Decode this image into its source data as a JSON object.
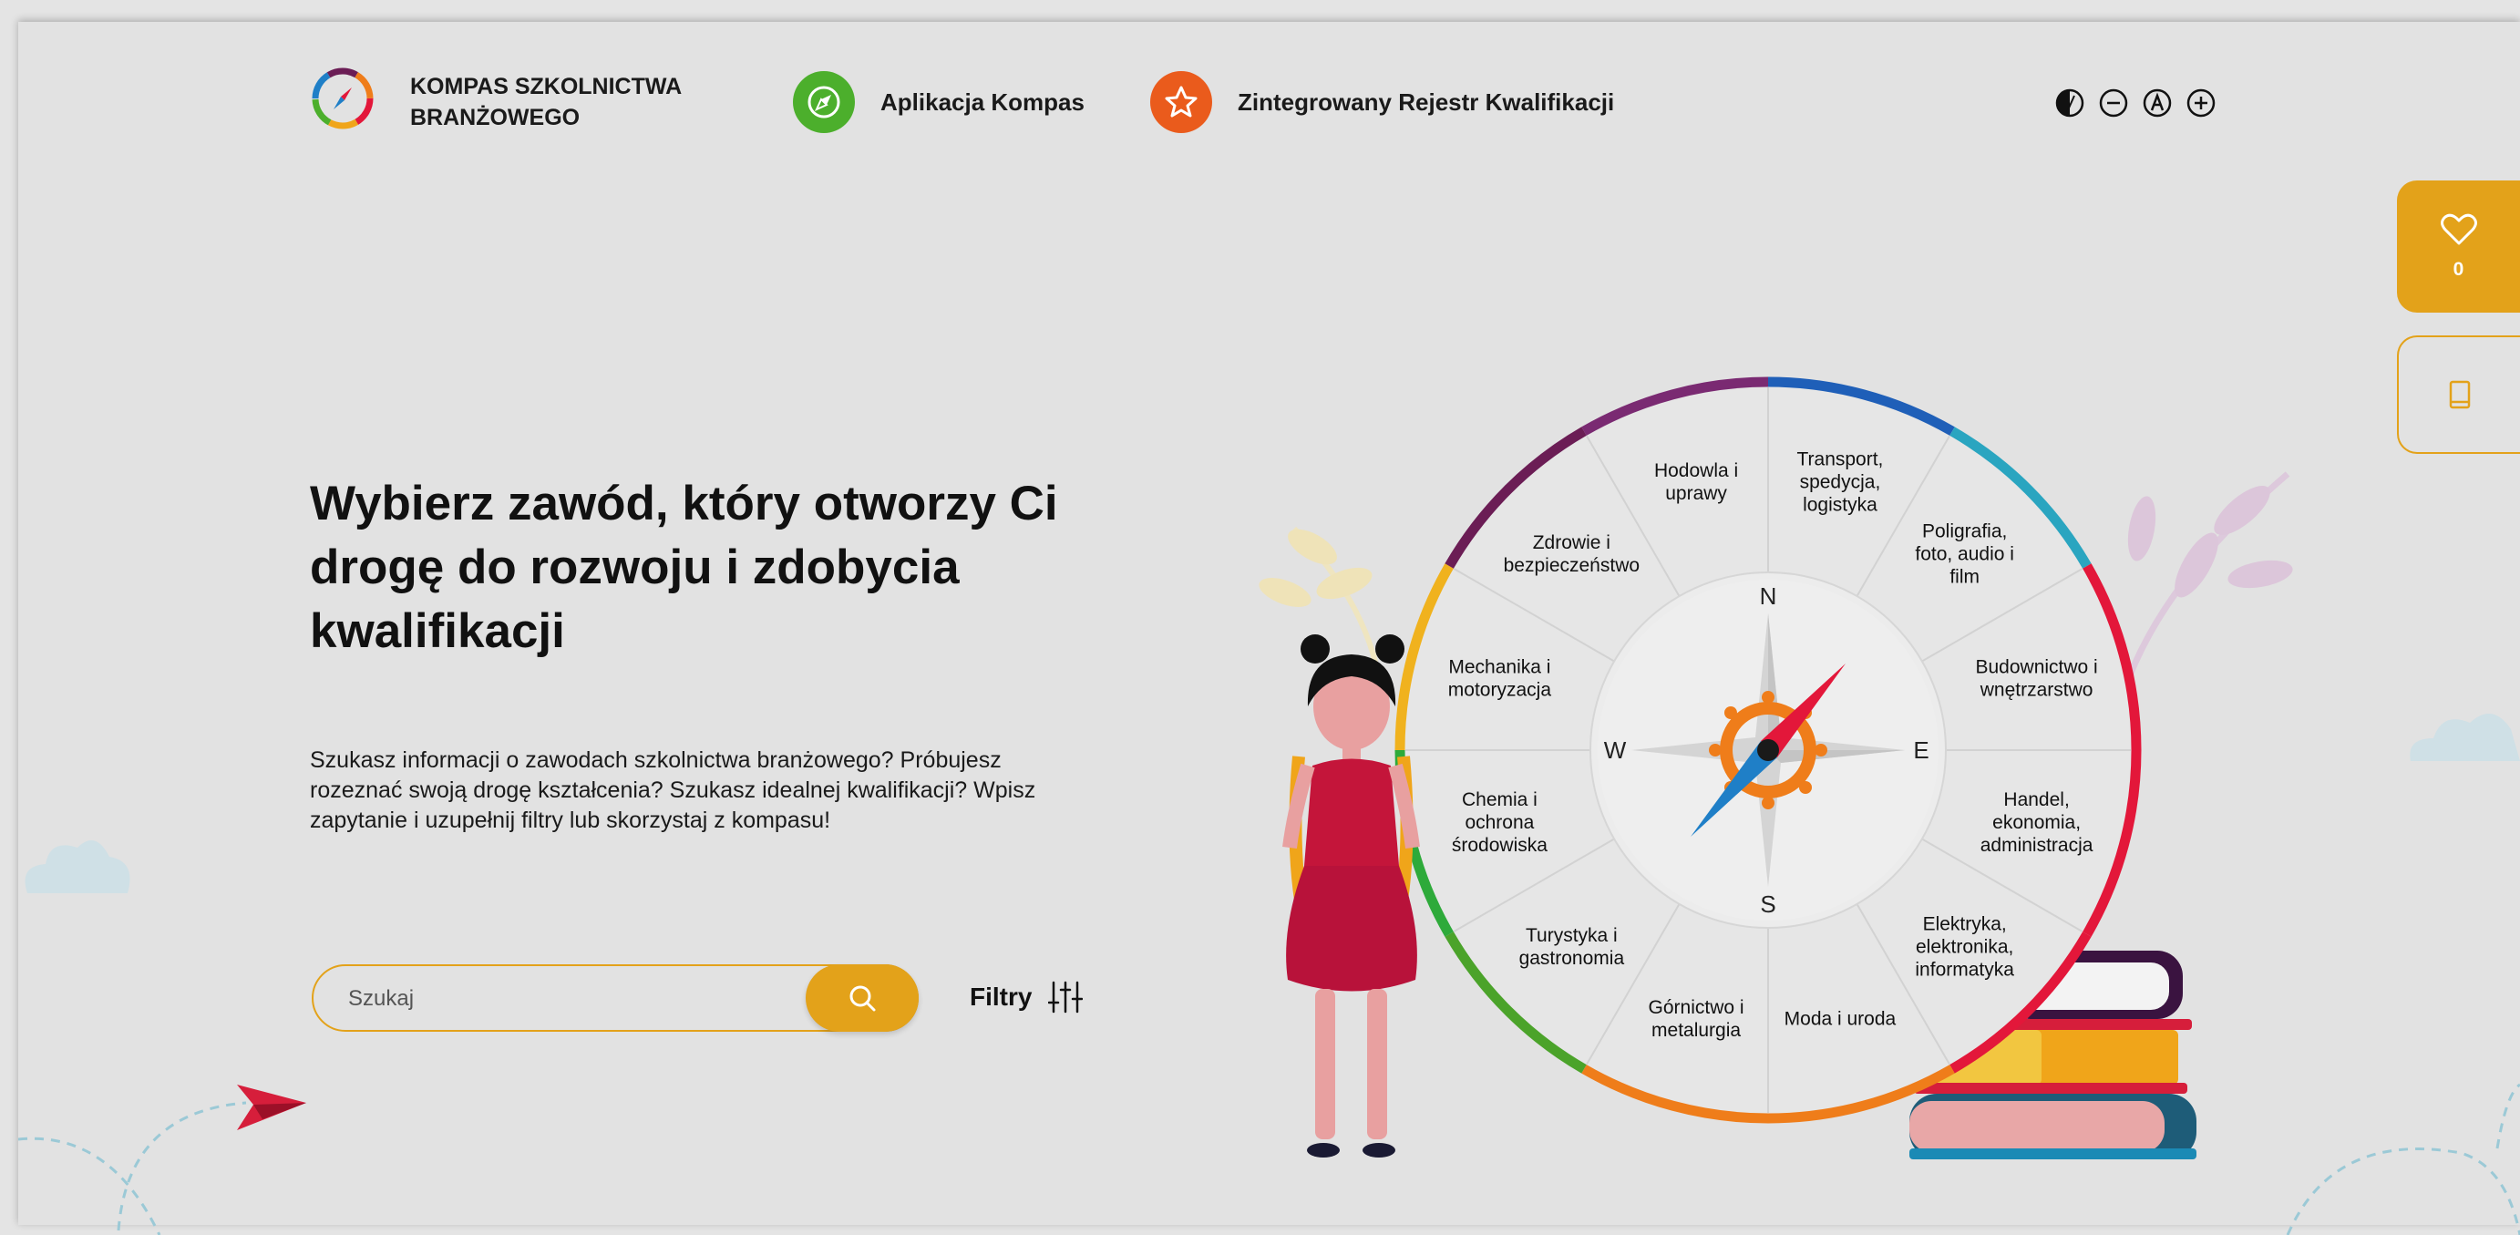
{
  "header": {
    "logo_text": "KOMPAS SZKOLNICTWA BRANŻOWEGO",
    "nav": [
      {
        "label": "Aplikacja Kompas",
        "icon": "compass-icon",
        "color": "#4caf2c"
      },
      {
        "label": "Zintegrowany Rejestr Kwalifikacji",
        "icon": "star-icon",
        "color": "#ea5b1c"
      }
    ],
    "accessibility": [
      {
        "icon": "contrast-icon"
      },
      {
        "icon": "zoom-out-icon"
      },
      {
        "icon": "font-reset-icon"
      },
      {
        "icon": "zoom-in-icon"
      }
    ]
  },
  "side_tabs": {
    "favorites_count": "0",
    "favorites_icon": "heart-icon",
    "book_icon": "book-icon"
  },
  "hero": {
    "heading": "Wybierz zawód, który otworzy Ci drogę do rozwoju i zdobycia kwalifikacji",
    "intro": "Szukasz informacji o zawodach szkolnictwa branżowego? Próbujesz rozeznać swoją drogę kształcenia? Szukasz idealnej kwalifikacji? Wpisz zapytanie i uzupełnij filtry lub skorzystaj z kompasu!"
  },
  "search": {
    "placeholder": "Szukaj",
    "value": "",
    "filters_label": "Filtry"
  },
  "compass": {
    "directions": {
      "n": "N",
      "e": "E",
      "s": "S",
      "w": "W"
    },
    "sectors": [
      {
        "lines": [
          "Transport,",
          "spedycja,",
          "logistyka"
        ]
      },
      {
        "lines": [
          "Poligrafia,",
          "foto, audio i",
          "film"
        ]
      },
      {
        "lines": [
          "Budownictwo i",
          "wnętrzarstwo"
        ]
      },
      {
        "lines": [
          "Handel,",
          "ekonomia,",
          "administracja"
        ]
      },
      {
        "lines": [
          "Elektryka,",
          "elektronika,",
          "informatyka"
        ]
      },
      {
        "lines": [
          "Moda i uroda"
        ]
      },
      {
        "lines": [
          "Górnictwo i",
          "metalurgia"
        ]
      },
      {
        "lines": [
          "Turystyka i",
          "gastronomia"
        ]
      },
      {
        "lines": [
          "Chemia i",
          "ochrona",
          "środowiska"
        ]
      },
      {
        "lines": [
          "Mechanika i",
          "motoryzacja"
        ]
      },
      {
        "lines": [
          "Zdrowie i",
          "bezpieczeństwo"
        ]
      },
      {
        "lines": [
          "Hodowla i",
          "uprawy"
        ]
      }
    ],
    "ring_colors": [
      "#1f5fb8",
      "#2aa5c0",
      "#e3173a",
      "#e3173a",
      "#e3173a",
      "#ef7d1a",
      "#ef7d1a",
      "#4ba32a",
      "#2eaa3a",
      "#f0b21e",
      "#6b1d55",
      "#7a2a72"
    ]
  },
  "colors": {
    "accent": "#e3a21a",
    "background": "#e2e2e2",
    "green": "#4caf2c",
    "orange": "#ea5b1c"
  }
}
